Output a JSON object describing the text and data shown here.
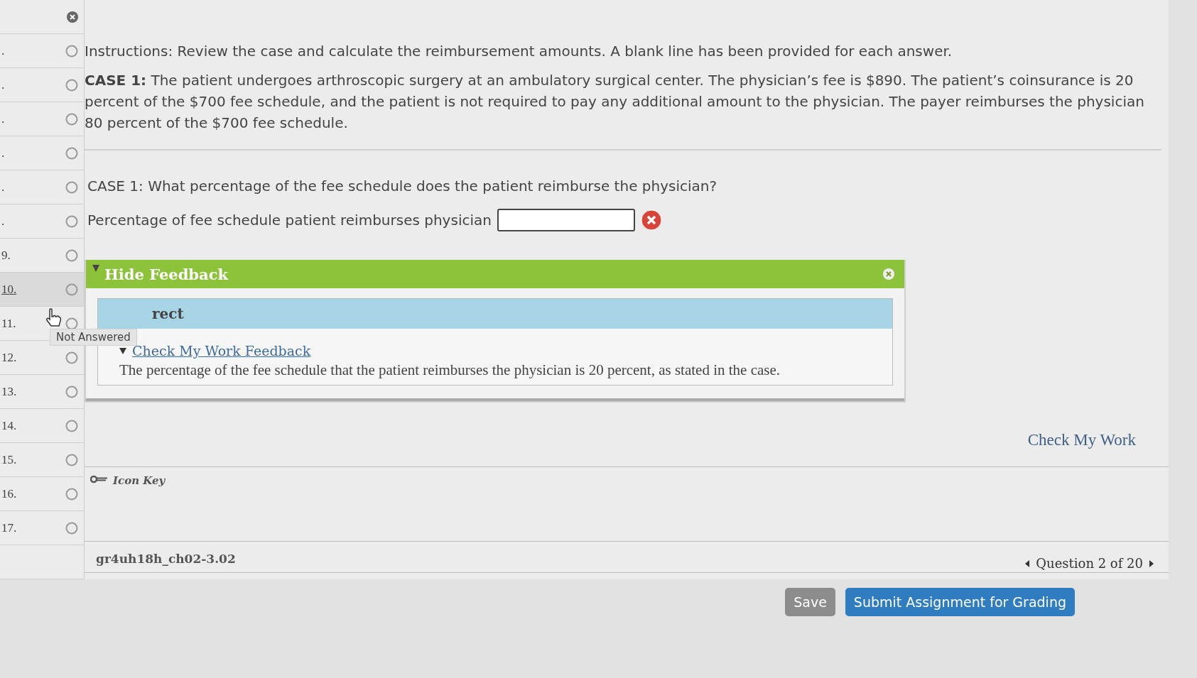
{
  "sidebar": {
    "items": [
      {
        "kind": "incorrect",
        "selected": false
      },
      {
        "number": ".",
        "kind": "unanswered",
        "selected": false
      },
      {
        "number": ".",
        "kind": "unanswered",
        "selected": false
      },
      {
        "number": ".",
        "kind": "unanswered",
        "selected": false
      },
      {
        "number": ".",
        "kind": "unanswered",
        "selected": false
      },
      {
        "number": ".",
        "kind": "unanswered",
        "selected": false
      },
      {
        "number": ".",
        "kind": "unanswered",
        "selected": false
      },
      {
        "number": "9.",
        "kind": "unanswered",
        "selected": false
      },
      {
        "number": "10.",
        "kind": "unanswered",
        "selected": true
      },
      {
        "number": "11.",
        "kind": "unanswered",
        "selected": false
      },
      {
        "number": "12.",
        "kind": "unanswered",
        "selected": false
      },
      {
        "number": "13.",
        "kind": "unanswered",
        "selected": false
      },
      {
        "number": "14.",
        "kind": "unanswered",
        "selected": false
      },
      {
        "number": "15.",
        "kind": "unanswered",
        "selected": false
      },
      {
        "number": "16.",
        "kind": "unanswered",
        "selected": false
      },
      {
        "number": "17.",
        "kind": "unanswered",
        "selected": false
      }
    ],
    "tooltip": "Not Answered"
  },
  "instructions": "Instructions: Review the case and calculate the reimbursement amounts. A blank line has been provided for each answer.",
  "case": "**CASE 1:** The patient undergoes arthroscopic surgery at an ambulatory surgical center. The physician’s fee is $890. The patient’s coinsurance is 20 percent of the $700 fee schedule, and the patient is not required to pay any additional amount to the physician. The payer reimburses the physician 80 percent of the $700 fee schedule.",
  "question": "CASE 1: What percentage of the fee schedule does the patient reimburse the physician?",
  "answer": {
    "label": "Percentage of fee schedule patient reimburses physician",
    "kind": "incorrect"
  },
  "feedback": {
    "toggle": "Hide Feedback",
    "expanded": true,
    "result": "rect",
    "link": "Check My Work Feedback",
    "text": "The percentage of the fee schedule that the patient reimburses the physician is 20 percent, as stated in the case."
  },
  "check_my_work": "Check My Work",
  "icon_key": "Icon Key",
  "question_id": "gr4uh18h_ch02-3.02",
  "pager": "Question 2 of 20",
  "buttons": [
    {
      "label": "Save",
      "kind": "secondary"
    },
    {
      "label": "Submit Assignment for Grading",
      "kind": "primary"
    }
  ]
}
